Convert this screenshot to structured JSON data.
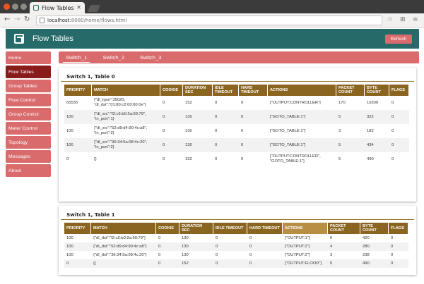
{
  "browser": {
    "tab_title": "Flow Tables",
    "url_host": "localhost",
    "url_path": ":8080/home/flows.html"
  },
  "app": {
    "title": "Flow Tables",
    "refresh_label": "Refresh"
  },
  "sidebar": {
    "items": [
      "Home",
      "Flow Tables",
      "Group Tables",
      "Flow Control",
      "Group Control",
      "Meter Control",
      "Topology",
      "Messages",
      "About"
    ],
    "active": "Flow Tables"
  },
  "switch_tabs": [
    "Switch_1",
    "Switch_2",
    "Switch_3"
  ],
  "table0": {
    "title": "Switch 1, Table 0",
    "headers": [
      "PRIORITY",
      "MATCH",
      "COOKIE",
      "DURATION SEC",
      "IDLE TIMEOUT",
      "HARD TIMEOUT",
      "ACTIONS",
      "PACKET COUNT",
      "BYTE COUNT",
      "FLAGS"
    ],
    "rows": [
      [
        "65535",
        "{\"dl_type\":35020, \"dl_dst\":\"01:80:c2:00:00:0e\"}",
        "0",
        "152",
        "0",
        "0",
        "[\"OUTPUT:CONTROLLER\"]",
        "170",
        "10200",
        "0"
      ],
      [
        "100",
        "{\"dl_src\":\"f2:c5:b0:2a:60:79\", \"in_port\":1}",
        "0",
        "130",
        "0",
        "0",
        "[\"GOTO_TABLE:1\"]",
        "5",
        "322",
        "0"
      ],
      [
        "100",
        "{\"dl_src\":\"52:d9:d4:90:4c:a8\", \"in_port\":2}",
        "0",
        "130",
        "0",
        "0",
        "[\"GOTO_TABLE:1\"]",
        "3",
        "182",
        "0"
      ],
      [
        "100",
        "{\"dl_src\":\"36:34:5a:08:4c:20\", \"in_port\":2}",
        "0",
        "130",
        "0",
        "0",
        "[\"GOTO_TABLE:1\"]",
        "5",
        "434",
        "0"
      ],
      [
        "0",
        "{}",
        "0",
        "152",
        "0",
        "0",
        "[\"OUTPUT:CONTROLLER\", \"GOTO_TABLE:1\"]",
        "5",
        "490",
        "0"
      ]
    ]
  },
  "table1": {
    "title": "Switch 1, Table 1",
    "headers": [
      "PRIORITY",
      "MATCH",
      "COOKIE",
      "DURATION SEC",
      "IDLE TIMEOUT",
      "HARD TIMEOUT",
      "ACTIONS",
      "PACKET COUNT",
      "BYTE COUNT",
      "FLAGS"
    ],
    "rows": [
      [
        "100",
        "{\"dl_dst\":\"f2:c5:b0:2a:60:79\"}",
        "0",
        "130",
        "0",
        "0",
        "[\"OUTPUT:1\"]",
        "6",
        "420",
        "0"
      ],
      [
        "100",
        "{\"dl_dst\":\"52:d9:d4:90:4c:a8\"}",
        "0",
        "130",
        "0",
        "0",
        "[\"OUTPUT:2\"]",
        "4",
        "280",
        "0"
      ],
      [
        "100",
        "{\"dl_dst\":\"36:34:5a:08:4c:20\"}",
        "0",
        "130",
        "0",
        "0",
        "[\"OUTPUT:2\"]",
        "3",
        "238",
        "0"
      ],
      [
        "0",
        "{}",
        "0",
        "152",
        "0",
        "0",
        "[\"OUTPUT:FLOOD\"]",
        "5",
        "490",
        "0"
      ]
    ]
  },
  "colors": {
    "header_bg": "#266b6a",
    "accent": "#d96b6c",
    "active_nav": "#8a1b1b",
    "table_header": "#8a6520"
  }
}
